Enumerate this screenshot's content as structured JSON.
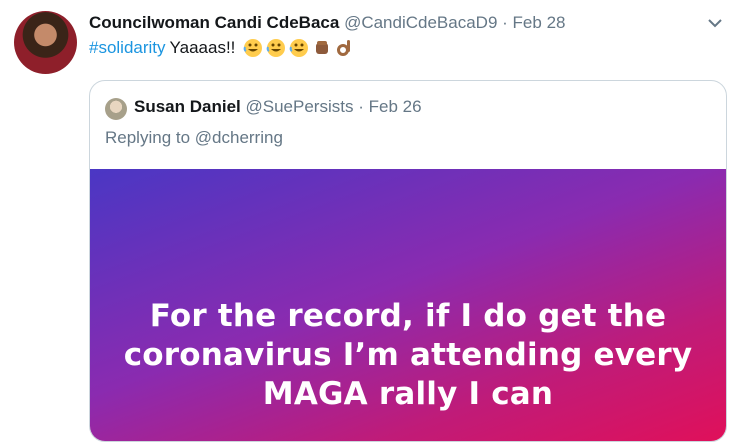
{
  "tweet": {
    "author_name": "Councilwoman Candi CdeBaca",
    "handle": "@CandiCdeBacaD9",
    "separator": "·",
    "date": "Feb 28",
    "hashtag": "#solidarity",
    "text": "Yaaaas!!",
    "emojis": [
      "rolling-on-floor-laughing",
      "rolling-on-floor-laughing",
      "rolling-on-floor-laughing",
      "raised-fist-medium-dark",
      "ok-hand-medium-dark"
    ]
  },
  "quoted_tweet": {
    "author_name": "Susan Daniel",
    "handle": "@SuePersists",
    "separator": "·",
    "date": "Feb 26",
    "replying_to": "Replying to @dcherring",
    "media_text_lines": [
      "For the record, if I do get the",
      "coronavirus I’m attending every",
      "MAGA rally I can"
    ]
  },
  "colors": {
    "link": "#1b95e0",
    "secondary_text": "#657786",
    "border": "#ccd6dd"
  }
}
